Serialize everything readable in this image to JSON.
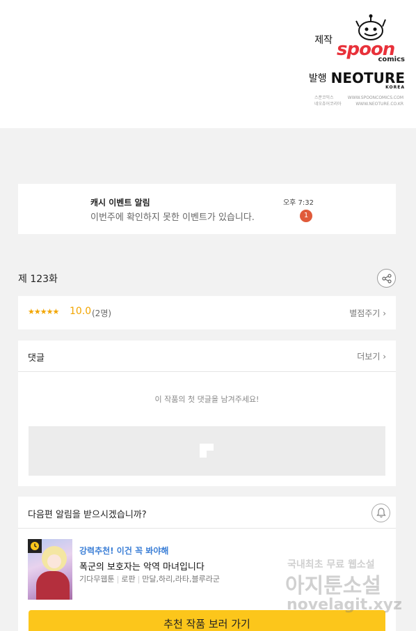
{
  "credits": {
    "produce_label": "제작",
    "spoon_logo_text": "spoon",
    "spoon_logo_sub": "comics",
    "publish_label": "발행",
    "neoture_logo_text": "NEOTURE",
    "neoture_logo_sub": "KOREA",
    "small_left_1": "스푼코믹스",
    "small_right_1": "WWW.SPOONCOMICS.COM",
    "small_left_2": "네오츄어코리아",
    "small_right_2": "WWW.NEOTURE.CO.KR"
  },
  "notification": {
    "title": "캐시 이벤트 알림",
    "message": "이번주에 확인하지 못한 이벤트가 있습니다.",
    "time": "오후 7:32",
    "badge": "1"
  },
  "episode": {
    "title": "제 123화",
    "share_icon": "share-icon"
  },
  "rating": {
    "stars": "★★★★★",
    "score": "10.0",
    "count": "(2명)",
    "rate_link": "별점주기"
  },
  "comments": {
    "title": "댓글",
    "more": "더보기",
    "empty": "이 작품의 첫 댓글을 남겨주세요!"
  },
  "next_episode": {
    "question": "다음편 알림을 받으시겠습니까?",
    "bell_icon": "bell-icon",
    "rec_tag": "강력추천! 이건 꼭 봐야해",
    "rec_title": "폭군의 보호자는 악역 마녀입니다",
    "rec_meta": [
      "기다무웹툰",
      "로판",
      "만달,하리,라타,블루라군"
    ],
    "button": "추천 작품 보러 가기"
  },
  "watermark": {
    "line1": "국내최초 무료 웹소설",
    "line2": "아지툰소설",
    "line3": "novelagit.xyz"
  },
  "colors": {
    "accent_yellow": "#fcc61b",
    "star_orange": "#f2a500",
    "badge_red": "#e05a3a",
    "link_blue": "#3a7ed6",
    "spoon_red": "#e8313a"
  }
}
